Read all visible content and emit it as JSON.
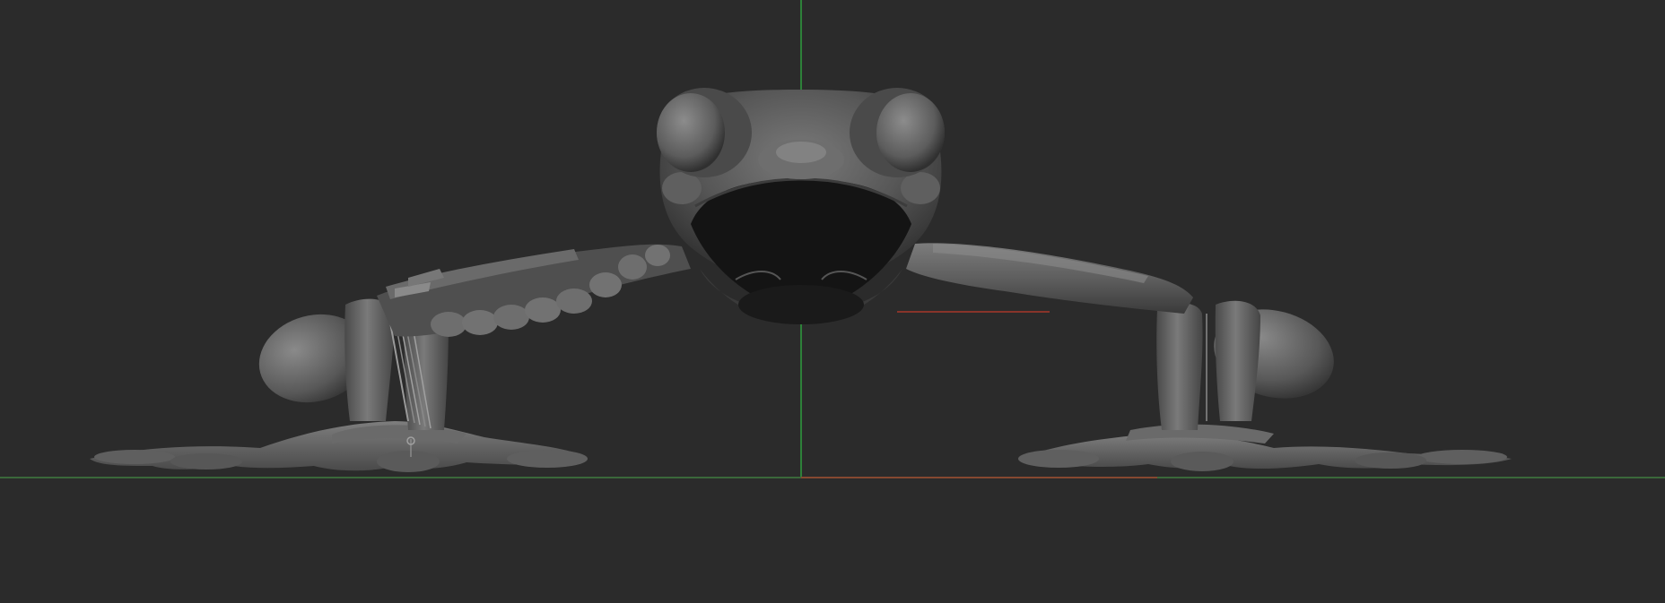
{
  "viewport": {
    "background": "#2b2b2b",
    "grid_axis_colors": {
      "x_axis": "#c0392b",
      "y_axis": "#2e9e3e",
      "ground_line": "#3f7d3f"
    },
    "model": {
      "subject": "frog-sculpt",
      "material_base": "#5a5a5a",
      "material_highlight": "#8a8a8a",
      "material_shadow": "#1e1e1e"
    }
  }
}
